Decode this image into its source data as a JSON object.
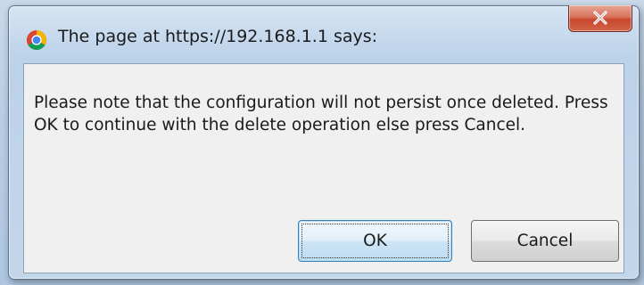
{
  "dialog": {
    "title": "The page at https://192.168.1.1 says:",
    "message": "Please note that the configuration will not persist once deleted. Press OK to continue with the delete operation else press Cancel.",
    "ok_label": "OK",
    "cancel_label": "Cancel",
    "close_icon": "close-x-icon",
    "app_icon": "chrome-icon"
  },
  "colors": {
    "close_button": "#c7472c",
    "focus_border": "#3c7fb1",
    "content_background": "#f0f0f0"
  }
}
